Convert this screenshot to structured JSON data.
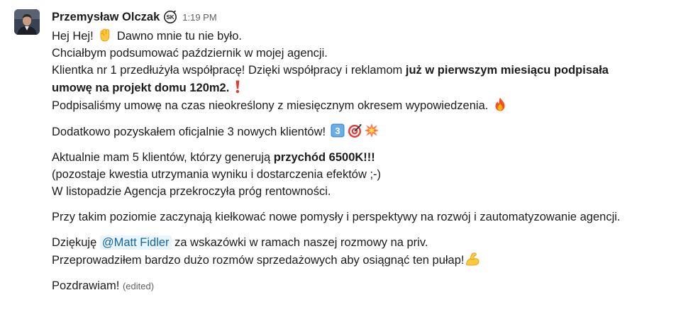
{
  "message": {
    "author": "Przemysław Olczak",
    "status_badge_text": "SK",
    "time": "1:19 PM",
    "mention": "@Matt Fidler",
    "edited": "(edited)",
    "lines": {
      "l1a": "Hej Hej!",
      "l1b": "Dawno mnie tu nie było.",
      "l2": "Chciałbym podsumować październik w mojej agencji.",
      "l3a": "Klientka nr 1 przedłużyła współpracę! Dzięki współpracy i reklamom ",
      "l3b": "już w pierwszym miesiącu podpisała",
      "l4": "umowę na projekt domu 120m2.",
      "l5": "Podpisaliśmy umowę na czas nieokreślony z miesięcznym okresem wypowiedzenia.",
      "l6": "Dodatkowo pozyskałem oficjalnie 3 nowych klientów!",
      "l7a": "Aktualnie mam 5 klientów, którzy generują ",
      "l7b": "przychód 6500K!!!",
      "l8": "(pozostaje kwestia utrzymania wyniku i dostarczenia efektów ;-)",
      "l9": "W listopadzie Agencja przekroczyła próg rentowności.",
      "l10": "Przy takim poziomie zaczynają kiełkować nowe pomysły i perspektywy na rozwój i zautomatyzowanie agencji.",
      "l11a": "Dziękuję ",
      "l11b": " za wskazówki w ramach naszej rozmowy na priv.",
      "l12": "Przeprowadziłem bardzo dużo rozmów sprzedażowych aby osiągnąć ten pułap!",
      "l13": "Pozdrawiam!"
    },
    "emojis": {
      "fist": "raised-fist",
      "exclamation": "red-exclamation",
      "fire": "fire",
      "keycap": "keycap-3",
      "keycap_text": "3",
      "target": "direct-hit",
      "collision": "collision",
      "muscle": "flexed-biceps"
    }
  },
  "colors": {
    "mention_bg": "#e8f5fa",
    "mention_text": "#1264a3",
    "muted_text": "#616061",
    "text": "#1d1c1d"
  }
}
